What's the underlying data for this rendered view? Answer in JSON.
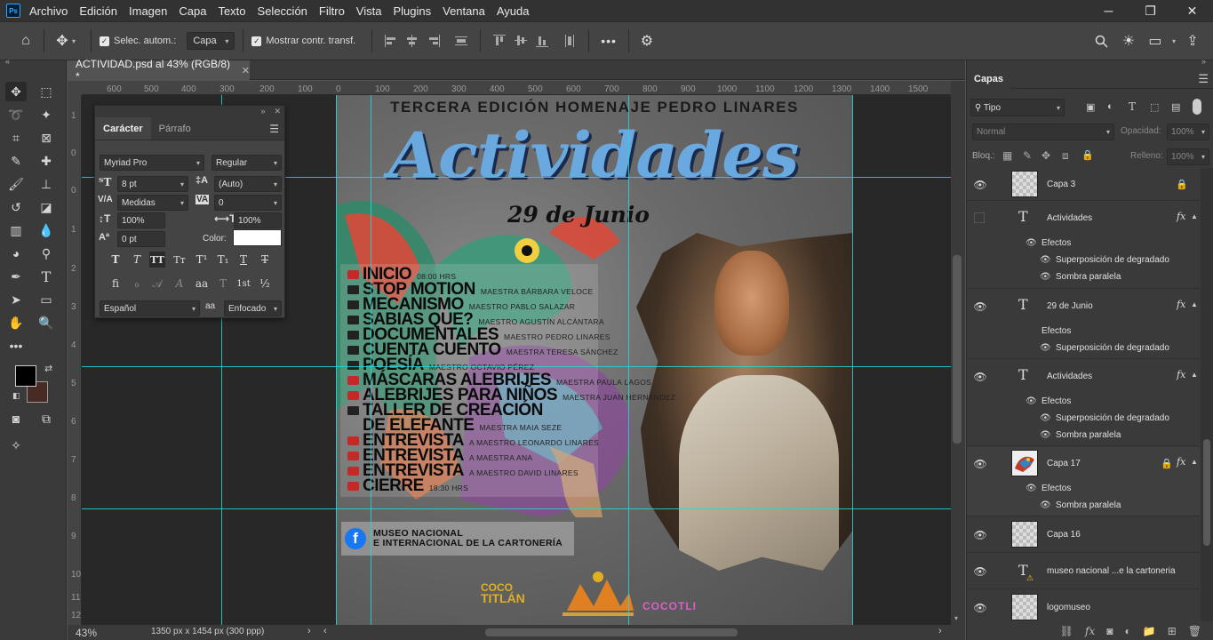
{
  "menubar": {
    "logo": "Ps",
    "items": [
      "Archivo",
      "Edición",
      "Imagen",
      "Capa",
      "Texto",
      "Selección",
      "Filtro",
      "Vista",
      "Plugins",
      "Ventana",
      "Ayuda"
    ],
    "window_controls": [
      "minimize-icon",
      "restore-icon",
      "close-icon"
    ]
  },
  "options_bar": {
    "auto_select_label": "Selec. autom.:",
    "auto_select_target": "Capa",
    "show_transform_label": "Mostrar contr. transf.",
    "more": "•••"
  },
  "document": {
    "tab_title": "ACTIVIDAD.psd al 43% (RGB/8) *",
    "zoom": "43%",
    "info": "1350 px x 1454 px (300 ppp)"
  },
  "rulers": {
    "h_labels": [
      "600",
      "500",
      "400",
      "300",
      "200",
      "100",
      "0",
      "100",
      "200",
      "300",
      "400",
      "500",
      "600",
      "700",
      "800",
      "900",
      "1000",
      "1100",
      "1200",
      "1300",
      "1400",
      "1500"
    ],
    "v_labels": [
      "1",
      "0",
      "0",
      "1",
      "2",
      "3",
      "4",
      "5",
      "6",
      "7",
      "8",
      "9",
      "10",
      "11",
      "12"
    ]
  },
  "poster": {
    "title": "TERCERA EDICIÓN HOMENAJE PEDRO LINARES",
    "headline": "Actividades",
    "date": "29 de Junio",
    "schedule": [
      {
        "icon": "live",
        "title": "INICIO",
        "sub": "08:00 HRS"
      },
      {
        "icon": "film",
        "title": "STOP MOTION",
        "sub": "MAESTRA BÁRBARA VELOCE"
      },
      {
        "icon": "film",
        "title": "MECANISMO",
        "sub": "MAESTRO PABLO SALAZAR"
      },
      {
        "icon": "film",
        "title": "SABIAS QUE?",
        "sub": "MAESTRO AGUSTÍN ALCÁNTARA"
      },
      {
        "icon": "film",
        "title": "DOCUMENTALES",
        "sub": "MAESTRO PEDRO LINARES"
      },
      {
        "icon": "film",
        "title": "CUENTA CUENTO",
        "sub": "MAESTRA TERESA SÁNCHEZ"
      },
      {
        "icon": "film",
        "title": "POESÍA",
        "sub": "MAESTRO OCTAVIO PÉREZ"
      },
      {
        "icon": "live",
        "title": "MÁSCARAS ALEBRIJES",
        "sub": "MAESTRA PAULA LAGOS"
      },
      {
        "icon": "live",
        "title": "ALEBRIJES PARA NIÑOS",
        "sub": "MAESTRA JUAN HERNÁNDEZ"
      },
      {
        "icon": "film",
        "title": "TALLER DE CREACIÓN",
        "sub": ""
      },
      {
        "icon": "none",
        "title": "DE ELEFANTE",
        "sub": "MAESTRA MAIA SEZE"
      },
      {
        "icon": "live",
        "title": "ENTREVISTA",
        "sub": "A MAESTRO LEONARDO LINARES"
      },
      {
        "icon": "live",
        "title": "ENTREVISTA",
        "sub": "A MAESTRA ANA"
      },
      {
        "icon": "live",
        "title": "ENTREVISTA",
        "sub": "A MAESTRO DAVID LINARES"
      },
      {
        "icon": "live",
        "title": "CIERRE",
        "sub": "18:30 HRS"
      }
    ],
    "fb_line1": "MUSEO NACIONAL",
    "fb_line2": "E INTERNACIONAL DE LA CARTONERÍA",
    "logo1_a": "COCO",
    "logo1_b": "TITLÁN",
    "logo3": "COCOTLI"
  },
  "char_panel": {
    "tabs": [
      "Carácter",
      "Párrafo"
    ],
    "font_family": "Myriad Pro",
    "font_style": "Regular",
    "font_size": "8 pt",
    "leading": "(Auto)",
    "kerning": "Medidas",
    "tracking": "0",
    "vscale": "100%",
    "hscale": "100%",
    "baseline": "0 pt",
    "color_label": "Color:",
    "language": "Español",
    "aa_label": "aa",
    "antialias": "Enfocado"
  },
  "layers_panel": {
    "tab": "Capas",
    "filter": "Tipo",
    "blend_mode": "Normal",
    "opacity_label": "Opacidad:",
    "opacity": "100%",
    "lock_label": "Bloq.:",
    "fill_label": "Relleno:",
    "fill": "100%",
    "layers": [
      {
        "name": "Capa 3",
        "kind": "pixel",
        "visible": true,
        "locked": true,
        "fx": false,
        "effects_label": "",
        "effects": []
      },
      {
        "name": "Actividades",
        "kind": "text",
        "visible": false,
        "locked": false,
        "fx": true,
        "effects_label": "Efectos",
        "effects": [
          "Superposición de degradado",
          "Sombra paralela"
        ]
      },
      {
        "name": "29 de Junio",
        "kind": "text",
        "visible": true,
        "locked": false,
        "fx": true,
        "effects_label": "Efectos",
        "effects": [
          "Superposición de degradado"
        ]
      },
      {
        "name": "Actividades",
        "kind": "text",
        "visible": true,
        "locked": false,
        "fx": true,
        "effects_label": "Efectos",
        "effects": [
          "Superposición de degradado",
          "Sombra paralela"
        ]
      },
      {
        "name": "Capa 17",
        "kind": "image",
        "visible": true,
        "locked": true,
        "fx": true,
        "effects_label": "Efectos",
        "effects": [
          "Sombra paralela"
        ]
      },
      {
        "name": "Capa 16",
        "kind": "pixel",
        "visible": true,
        "locked": false,
        "fx": false,
        "effects_label": "",
        "effects": []
      },
      {
        "name": "museo nacional ...e la cartoneria",
        "kind": "text-warn",
        "visible": true,
        "locked": false,
        "fx": false,
        "effects_label": "",
        "effects": []
      },
      {
        "name": "logomuseo",
        "kind": "pixel",
        "visible": true,
        "locked": false,
        "fx": false,
        "effects_label": "",
        "effects": []
      }
    ]
  },
  "colors": {
    "foreground": "#000000",
    "background": "#4a2a25",
    "guide": "#23d7d7",
    "poster_blue": "#6aa8e0"
  }
}
